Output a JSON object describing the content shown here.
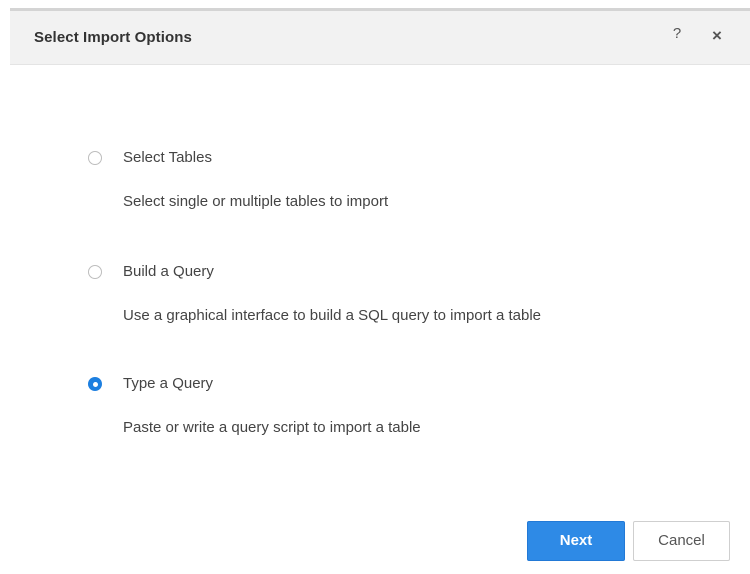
{
  "dialog": {
    "title": "Select Import Options",
    "help_label": "?",
    "close_label": "×"
  },
  "options": [
    {
      "label": "Select Tables",
      "description": "Select single or multiple tables to import",
      "selected": false
    },
    {
      "label": "Build a Query",
      "description": "Use a graphical interface to build a SQL query to import a table",
      "selected": false
    },
    {
      "label": "Type a Query",
      "description": "Paste or write a query script to import a table",
      "selected": true
    }
  ],
  "footer": {
    "next_label": "Next",
    "cancel_label": "Cancel"
  },
  "colors": {
    "accent": "#2e8ae6",
    "title_bar": "#f2f2f2",
    "text": "#444444"
  },
  "icons": {
    "help": "help-icon",
    "close": "close-icon",
    "radio_unchecked": "radio-unchecked-icon",
    "radio_checked": "radio-checked-icon"
  }
}
